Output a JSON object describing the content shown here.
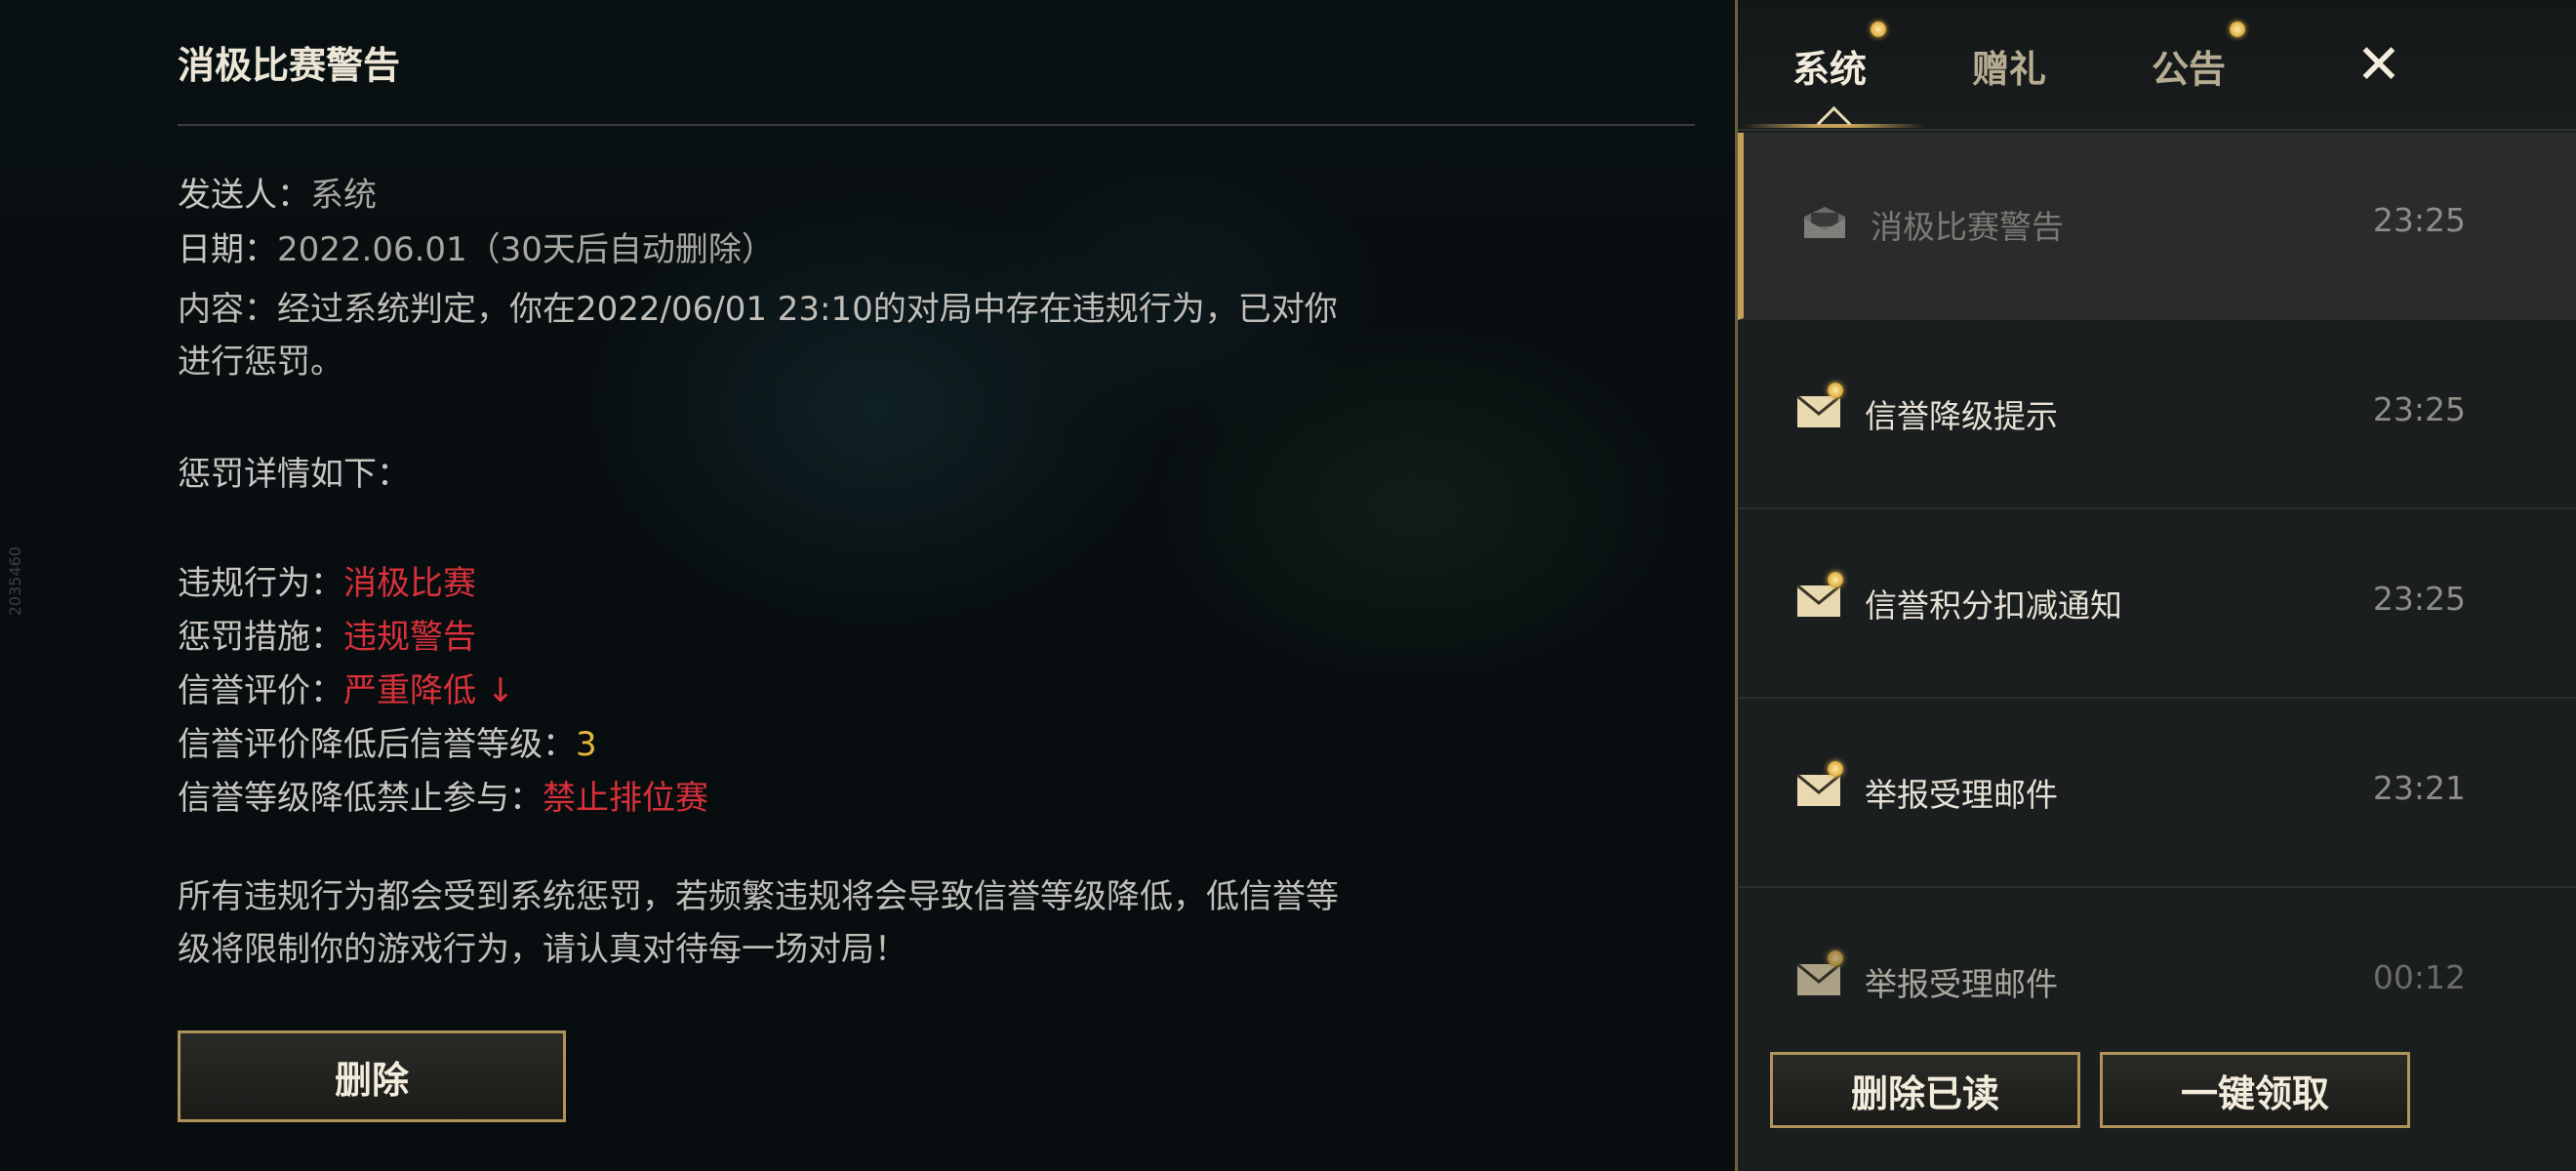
{
  "mail": {
    "title": "消极比赛警告",
    "sender_label": "发送人：",
    "sender_value": "系统",
    "date_label": "日期：",
    "date_value": "2022.06.01（30天后自动删除）",
    "content_prefix": "内容：",
    "content_text": "经过系统判定，你在2022/06/01 23:10的对局中存在违规行为，已对你进行惩罚。",
    "details_heading": "惩罚详情如下：",
    "violation_label": "违规行为：",
    "violation_value": "消极比赛",
    "penalty_label": "惩罚措施：",
    "penalty_value": "违规警告",
    "credit_label": "信誉评价：",
    "credit_value": "严重降低 ↓",
    "level_label": "信誉评价降低后信誉等级：",
    "level_value": "3",
    "ban_label": "信誉等级降低禁止参与：",
    "ban_value": "禁止排位赛",
    "footer_text": "所有违规行为都会受到系统惩罚，若频繁违规将会导致信誉等级降低，低信誉等级将限制你的游戏行为，请认真对待每一场对局！",
    "delete_button": "删除"
  },
  "side_tag": "2035460",
  "panel": {
    "tabs": [
      {
        "label": "系统",
        "has_dot": true,
        "active": true
      },
      {
        "label": "赠礼",
        "has_dot": false,
        "active": false
      },
      {
        "label": "公告",
        "has_dot": true,
        "active": false
      }
    ],
    "close_icon": "close-icon",
    "items": [
      {
        "title": "消极比赛警告",
        "time": "23:25",
        "read": true,
        "selected": true
      },
      {
        "title": "信誉降级提示",
        "time": "23:25",
        "read": false,
        "selected": false
      },
      {
        "title": "信誉积分扣减通知",
        "time": "23:25",
        "read": false,
        "selected": false
      },
      {
        "title": "举报受理邮件",
        "time": "23:21",
        "read": false,
        "selected": false
      },
      {
        "title": "举报受理邮件",
        "time": "00:12",
        "read": false,
        "selected": false
      }
    ],
    "delete_read_button": "删除已读",
    "claim_all_button": "一键领取"
  },
  "colors": {
    "accent_gold": "#c4a05a",
    "warning_red": "#d9303a",
    "level_gold": "#e6b83a"
  }
}
